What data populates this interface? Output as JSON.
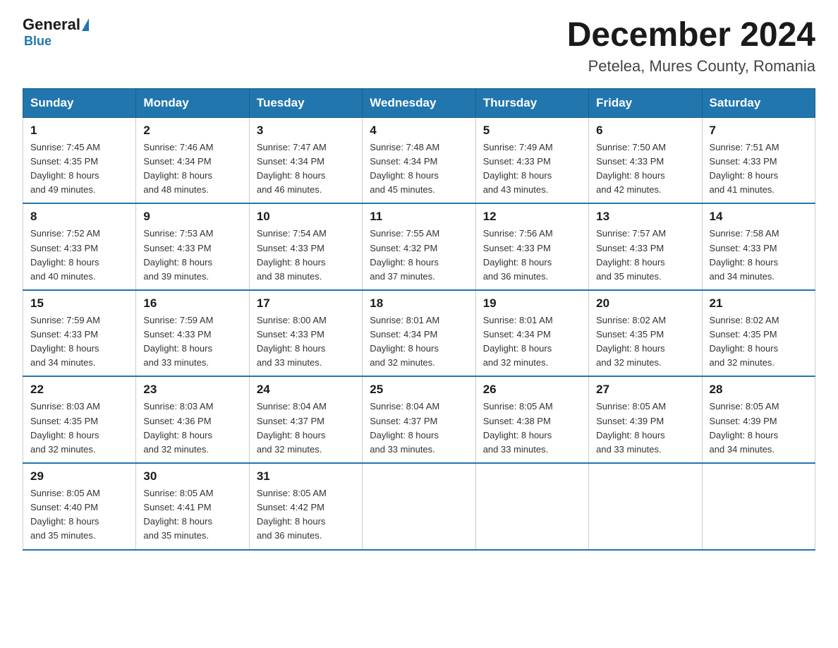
{
  "logo": {
    "general": "General",
    "triangle": "",
    "blue": "Blue"
  },
  "title": "December 2024",
  "subtitle": "Petelea, Mures County, Romania",
  "headers": [
    "Sunday",
    "Monday",
    "Tuesday",
    "Wednesday",
    "Thursday",
    "Friday",
    "Saturday"
  ],
  "weeks": [
    [
      {
        "day": "1",
        "sunrise": "7:45 AM",
        "sunset": "4:35 PM",
        "daylight": "8 hours and 49 minutes."
      },
      {
        "day": "2",
        "sunrise": "7:46 AM",
        "sunset": "4:34 PM",
        "daylight": "8 hours and 48 minutes."
      },
      {
        "day": "3",
        "sunrise": "7:47 AM",
        "sunset": "4:34 PM",
        "daylight": "8 hours and 46 minutes."
      },
      {
        "day": "4",
        "sunrise": "7:48 AM",
        "sunset": "4:34 PM",
        "daylight": "8 hours and 45 minutes."
      },
      {
        "day": "5",
        "sunrise": "7:49 AM",
        "sunset": "4:33 PM",
        "daylight": "8 hours and 43 minutes."
      },
      {
        "day": "6",
        "sunrise": "7:50 AM",
        "sunset": "4:33 PM",
        "daylight": "8 hours and 42 minutes."
      },
      {
        "day": "7",
        "sunrise": "7:51 AM",
        "sunset": "4:33 PM",
        "daylight": "8 hours and 41 minutes."
      }
    ],
    [
      {
        "day": "8",
        "sunrise": "7:52 AM",
        "sunset": "4:33 PM",
        "daylight": "8 hours and 40 minutes."
      },
      {
        "day": "9",
        "sunrise": "7:53 AM",
        "sunset": "4:33 PM",
        "daylight": "8 hours and 39 minutes."
      },
      {
        "day": "10",
        "sunrise": "7:54 AM",
        "sunset": "4:33 PM",
        "daylight": "8 hours and 38 minutes."
      },
      {
        "day": "11",
        "sunrise": "7:55 AM",
        "sunset": "4:32 PM",
        "daylight": "8 hours and 37 minutes."
      },
      {
        "day": "12",
        "sunrise": "7:56 AM",
        "sunset": "4:33 PM",
        "daylight": "8 hours and 36 minutes."
      },
      {
        "day": "13",
        "sunrise": "7:57 AM",
        "sunset": "4:33 PM",
        "daylight": "8 hours and 35 minutes."
      },
      {
        "day": "14",
        "sunrise": "7:58 AM",
        "sunset": "4:33 PM",
        "daylight": "8 hours and 34 minutes."
      }
    ],
    [
      {
        "day": "15",
        "sunrise": "7:59 AM",
        "sunset": "4:33 PM",
        "daylight": "8 hours and 34 minutes."
      },
      {
        "day": "16",
        "sunrise": "7:59 AM",
        "sunset": "4:33 PM",
        "daylight": "8 hours and 33 minutes."
      },
      {
        "day": "17",
        "sunrise": "8:00 AM",
        "sunset": "4:33 PM",
        "daylight": "8 hours and 33 minutes."
      },
      {
        "day": "18",
        "sunrise": "8:01 AM",
        "sunset": "4:34 PM",
        "daylight": "8 hours and 32 minutes."
      },
      {
        "day": "19",
        "sunrise": "8:01 AM",
        "sunset": "4:34 PM",
        "daylight": "8 hours and 32 minutes."
      },
      {
        "day": "20",
        "sunrise": "8:02 AM",
        "sunset": "4:35 PM",
        "daylight": "8 hours and 32 minutes."
      },
      {
        "day": "21",
        "sunrise": "8:02 AM",
        "sunset": "4:35 PM",
        "daylight": "8 hours and 32 minutes."
      }
    ],
    [
      {
        "day": "22",
        "sunrise": "8:03 AM",
        "sunset": "4:35 PM",
        "daylight": "8 hours and 32 minutes."
      },
      {
        "day": "23",
        "sunrise": "8:03 AM",
        "sunset": "4:36 PM",
        "daylight": "8 hours and 32 minutes."
      },
      {
        "day": "24",
        "sunrise": "8:04 AM",
        "sunset": "4:37 PM",
        "daylight": "8 hours and 32 minutes."
      },
      {
        "day": "25",
        "sunrise": "8:04 AM",
        "sunset": "4:37 PM",
        "daylight": "8 hours and 33 minutes."
      },
      {
        "day": "26",
        "sunrise": "8:05 AM",
        "sunset": "4:38 PM",
        "daylight": "8 hours and 33 minutes."
      },
      {
        "day": "27",
        "sunrise": "8:05 AM",
        "sunset": "4:39 PM",
        "daylight": "8 hours and 33 minutes."
      },
      {
        "day": "28",
        "sunrise": "8:05 AM",
        "sunset": "4:39 PM",
        "daylight": "8 hours and 34 minutes."
      }
    ],
    [
      {
        "day": "29",
        "sunrise": "8:05 AM",
        "sunset": "4:40 PM",
        "daylight": "8 hours and 35 minutes."
      },
      {
        "day": "30",
        "sunrise": "8:05 AM",
        "sunset": "4:41 PM",
        "daylight": "8 hours and 35 minutes."
      },
      {
        "day": "31",
        "sunrise": "8:05 AM",
        "sunset": "4:42 PM",
        "daylight": "8 hours and 36 minutes."
      },
      null,
      null,
      null,
      null
    ]
  ],
  "labels": {
    "sunrise_prefix": "Sunrise: ",
    "sunset_prefix": "Sunset: ",
    "daylight_prefix": "Daylight: "
  }
}
